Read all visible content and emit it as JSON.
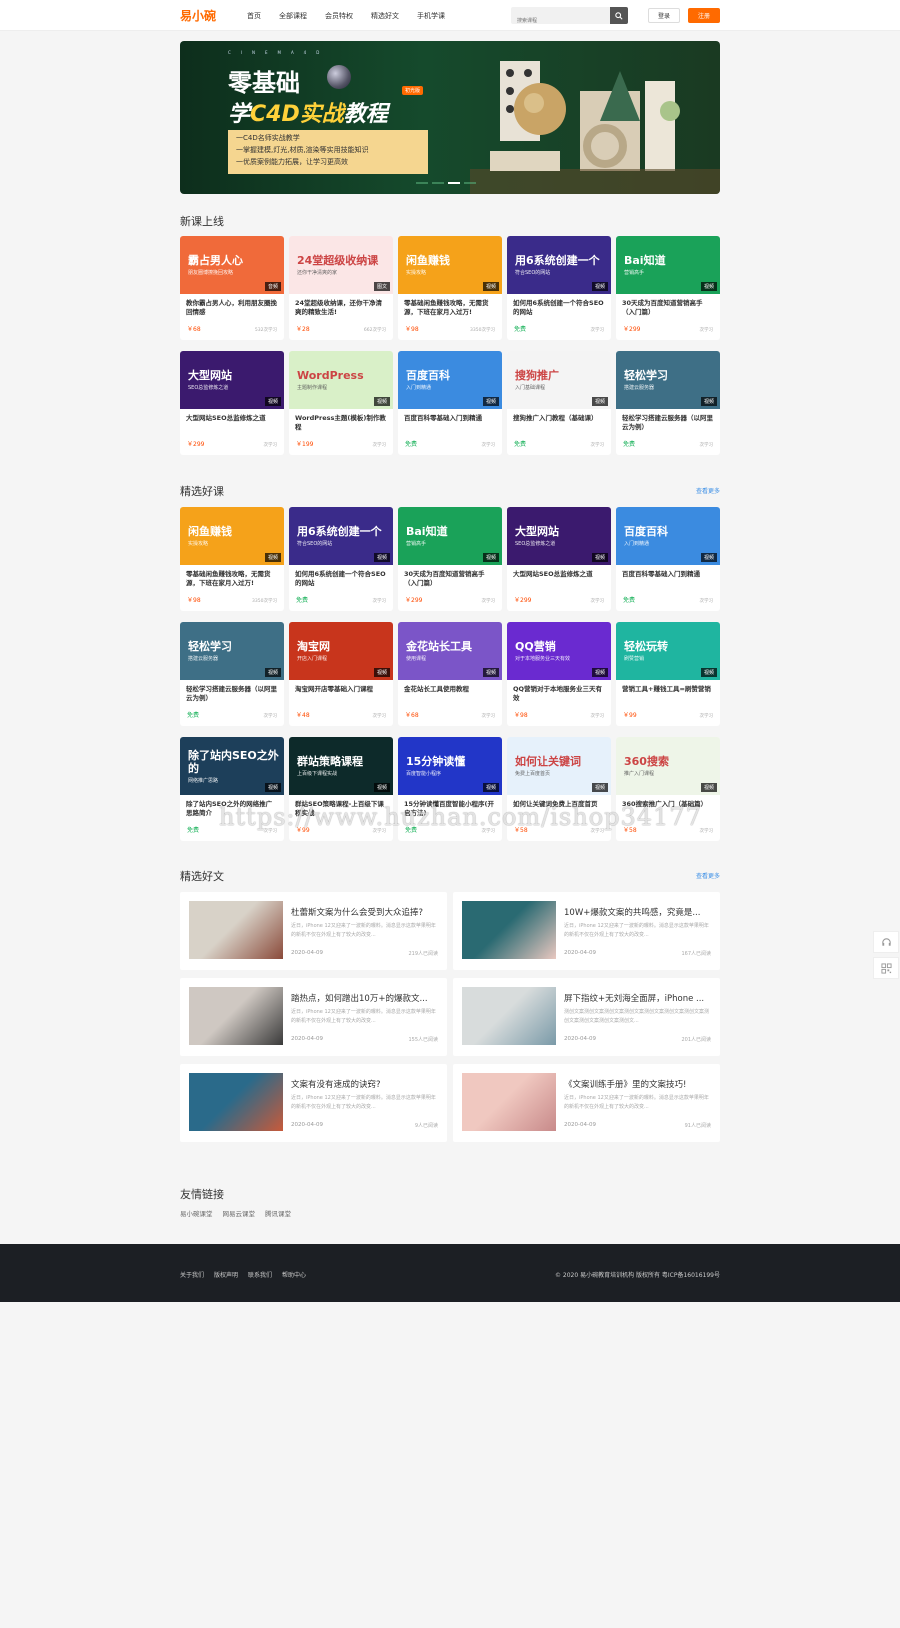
{
  "header": {
    "logo": "易小碗",
    "nav": [
      "首页",
      "全部课程",
      "会员特权",
      "精选好文",
      "手机学课"
    ],
    "search_placeholder": "搜索课程",
    "login": "登录",
    "register": "注册"
  },
  "banner": {
    "sub": "CINEMA4D",
    "title1": "零基础",
    "title2_pre": "学",
    "title2_hl": "C4D实战",
    "title2_post": "教程",
    "tag": "初光版",
    "bullets": [
      "一C4D名师实战教学",
      "一掌握建模,灯光,材质,渲染等实用技能知识",
      "一优质案例能力拓展，让学习更高效"
    ]
  },
  "new_courses": {
    "title": "新课上线",
    "items": [
      {
        "big": "霸占男人心",
        "sm": "朋友圈博撩挽回攻略",
        "badge": "音频",
        "name": "教你霸占男人心，利用朋友圈挽回情感",
        "price": "￥68",
        "count": "532次学习",
        "color": "#f06a3a",
        "free": false
      },
      {
        "big": "24堂超级收纳课",
        "sm": "还你干净清爽的家",
        "badge": "图文",
        "name": "24堂超级收纳课，还你干净清爽的精致生活!",
        "price": "￥28",
        "count": "662次学习",
        "color": "#fbe6e6",
        "free": false,
        "dark": true
      },
      {
        "big": "闲鱼赚钱",
        "sm": "实操攻略",
        "badge": "视频",
        "name": "零基础闲鱼赚钱攻略，无需货源，下班在家月入过万!",
        "price": "￥98",
        "count": "3350次学习",
        "color": "#f5a21a",
        "free": false
      },
      {
        "big": "用6系统创建一个",
        "sm": "符合SEO的网站",
        "badge": "视频",
        "name": "如何用6系统创建一个符合SEO的网站",
        "price": "免费",
        "count": "次学习",
        "color": "#3a2b8a",
        "free": true
      },
      {
        "big": "Bai知道",
        "sm": "营销高手",
        "badge": "视频",
        "name": "30天成为百度知道营销高手（入门篇）",
        "price": "￥299",
        "count": "次学习",
        "color": "#1aa259",
        "free": false
      },
      {
        "big": "大型网站",
        "sm": "SEO总监修炼之道",
        "badge": "视频",
        "name": "大型网站SEO总监修炼之道",
        "price": "￥299",
        "count": "次学习",
        "color": "#3b1a6e",
        "free": false
      },
      {
        "big": "WordPress",
        "sm": "主题制作课程",
        "badge": "视频",
        "name": "WordPress主题(模板)制作教程",
        "price": "￥199",
        "count": "次学习",
        "color": "#d9f0c8",
        "free": false,
        "dark": true
      },
      {
        "big": "百度百科",
        "sm": "入门到精通",
        "badge": "视频",
        "name": "百度百科零基础入门到精通",
        "price": "免费",
        "count": "次学习",
        "color": "#3b8be0",
        "free": true
      },
      {
        "big": "搜狗推广",
        "sm": "入门基础课程",
        "badge": "视频",
        "name": "搜狗推广入门教程（基础课）",
        "price": "免费",
        "count": "次学习",
        "color": "#f4f4f4",
        "free": true,
        "dark": true
      },
      {
        "big": "轻松学习",
        "sm": "搭建云服务器",
        "badge": "视频",
        "name": "轻松学习搭建云服务器（以阿里云为例）",
        "price": "免费",
        "count": "次学习",
        "color": "#3e6f86",
        "free": true
      }
    ]
  },
  "featured_courses": {
    "title": "精选好课",
    "more": "查看更多",
    "items": [
      {
        "big": "闲鱼赚钱",
        "sm": "实操攻略",
        "badge": "视频",
        "name": "零基础闲鱼赚钱攻略，无需货源，下班在家月入过万!",
        "price": "￥98",
        "count": "3350次学习",
        "color": "#f5a21a",
        "free": false
      },
      {
        "big": "用6系统创建一个",
        "sm": "符合SEO的网站",
        "badge": "视频",
        "name": "如何用6系统创建一个符合SEO的网站",
        "price": "免费",
        "count": "次学习",
        "color": "#3a2b8a",
        "free": true
      },
      {
        "big": "Bai知道",
        "sm": "营销高手",
        "badge": "视频",
        "name": "30天成为百度知道营销高手（入门篇）",
        "price": "￥299",
        "count": "次学习",
        "color": "#1aa259",
        "free": false
      },
      {
        "big": "大型网站",
        "sm": "SEO总监修炼之道",
        "badge": "视频",
        "name": "大型网站SEO总监修炼之道",
        "price": "￥299",
        "count": "次学习",
        "color": "#3b1a6e",
        "free": false
      },
      {
        "big": "百度百科",
        "sm": "入门到精通",
        "badge": "视频",
        "name": "百度百科零基础入门到精通",
        "price": "免费",
        "count": "次学习",
        "color": "#3b8be0",
        "free": true
      },
      {
        "big": "轻松学习",
        "sm": "搭建云服务器",
        "badge": "视频",
        "name": "轻松学习搭建云服务器（以阿里云为例）",
        "price": "免费",
        "count": "次学习",
        "color": "#3e6f86",
        "free": true
      },
      {
        "big": "淘宝网",
        "sm": "开店入门课程",
        "badge": "视频",
        "name": "淘宝网开店零基础入门课程",
        "price": "￥48",
        "count": "次学习",
        "color": "#c8351c",
        "free": false
      },
      {
        "big": "金花站长工具",
        "sm": "使用课程",
        "badge": "视频",
        "name": "金花站长工具使用教程",
        "price": "￥68",
        "count": "次学习",
        "color": "#7b55c8",
        "free": false
      },
      {
        "big": "QQ营销",
        "sm": "对于本地服务业三天有效",
        "badge": "视频",
        "name": "QQ营销对于本地服务业三天有效",
        "price": "￥98",
        "count": "次学习",
        "color": "#6a2ad0",
        "free": false
      },
      {
        "big": "轻松玩转",
        "sm": "刷赞营销",
        "badge": "视频",
        "name": "营销工具+赚钱工具=刷赞营销",
        "price": "￥99",
        "count": "次学习",
        "color": "#1fb5a0",
        "free": false
      },
      {
        "big": "除了站内SEO之外的",
        "sm": "网络推广思路",
        "badge": "视频",
        "name": "除了站内SEO之外的网络推广思路简介",
        "price": "免费",
        "count": "次学习",
        "color": "#1d3f5a",
        "free": true
      },
      {
        "big": "群站策略课程",
        "sm": "上百级下课程实战",
        "badge": "视频",
        "name": "群站SEO策略课程-上百级下课程实战",
        "price": "￥99",
        "count": "次学习",
        "color": "#0d2a2a",
        "free": false
      },
      {
        "big": "15分钟读懂",
        "sm": "百度智能小程序",
        "badge": "视频",
        "name": "15分钟读懂百度智能小程序(开启方法)",
        "price": "免费",
        "count": "次学习",
        "color": "#2236c8",
        "free": true
      },
      {
        "big": "如何让关键词",
        "sm": "免费上百度首页",
        "badge": "视频",
        "name": "如何让关键词免费上百度首页",
        "price": "￥58",
        "count": "次学习",
        "color": "#e6f1fb",
        "free": false,
        "dark": true
      },
      {
        "big": "360搜索",
        "sm": "推广入门课程",
        "badge": "视频",
        "name": "360搜索推广入门（基础篇）",
        "price": "￥58",
        "count": "次学习",
        "color": "#eef5e8",
        "free": false,
        "dark": true
      }
    ]
  },
  "articles": {
    "title": "精选好文",
    "more": "查看更多",
    "items": [
      {
        "title": "杜蕾斯文案为什么会受到大众追捧?",
        "desc": "近日，iPhone 12又迎来了一波新的曝料。消息显示这款苹果明年的新机不仅在外观上有了较大的改变...",
        "date": "2020-04-09",
        "reads": "219人已阅读",
        "c1": "#d8d2c8",
        "c2": "#8a4a3a"
      },
      {
        "title": "10W+爆款文案的共鸣感，究竟是...",
        "desc": "近日，iPhone 12又迎来了一波新的曝料。消息显示这款苹果明年的新机不仅在外观上有了较大的改变...",
        "date": "2020-04-09",
        "reads": "167人已阅读",
        "c1": "#2a6a72",
        "c2": "#e9c8c0"
      },
      {
        "title": "踏热点，如何蹭出10万+的爆款文...",
        "desc": "近日，iPhone 12又迎来了一波新的曝料。消息显示这款苹果明年的新机不仅在外观上有了较大的改变...",
        "date": "2020-04-09",
        "reads": "155人已阅读",
        "c1": "#cfc8c2",
        "c2": "#3a3a3a"
      },
      {
        "title": "屏下指纹+无刘海全面屏，iPhone ...",
        "desc": "测创文案测创文案测创文案测创文案测创文案测创文案测创文案测创文案测创文案测创文案测创文...",
        "date": "2020-04-09",
        "reads": "201人已阅读",
        "c1": "#d8dcdc",
        "c2": "#7a9aa8"
      },
      {
        "title": "文案有没有速成的诀窍?",
        "desc": "近日，iPhone 12又迎来了一波新的曝料。消息显示这款苹果明年的新机不仅在外观上有了较大的改变...",
        "date": "2020-04-09",
        "reads": "9人已阅读",
        "c1": "#2a6a8a",
        "c2": "#c85a3a"
      },
      {
        "title": "《文案训练手册》里的文案技巧!",
        "desc": "近日，iPhone 12又迎来了一波新的曝料。消息显示这款苹果明年的新机不仅在外观上有了较大的改变...",
        "date": "2020-04-09",
        "reads": "91人已阅读",
        "c1": "#f0c8c0",
        "c2": "#c88a8a"
      }
    ]
  },
  "links": {
    "title": "友情链接",
    "items": [
      "易小碗课堂",
      "网易云课堂",
      "腾讯课堂"
    ]
  },
  "footer": {
    "links": [
      "关于我们",
      "版权声明",
      "联系我们",
      "帮助中心"
    ],
    "copyright": "© 2020 易小碗教育培训机构 版权所有  粤ICP备16016199号"
  },
  "watermark": "https://www.huzhan.com/ishop34177",
  "side": [
    "headset-icon",
    "qrcode-icon"
  ]
}
